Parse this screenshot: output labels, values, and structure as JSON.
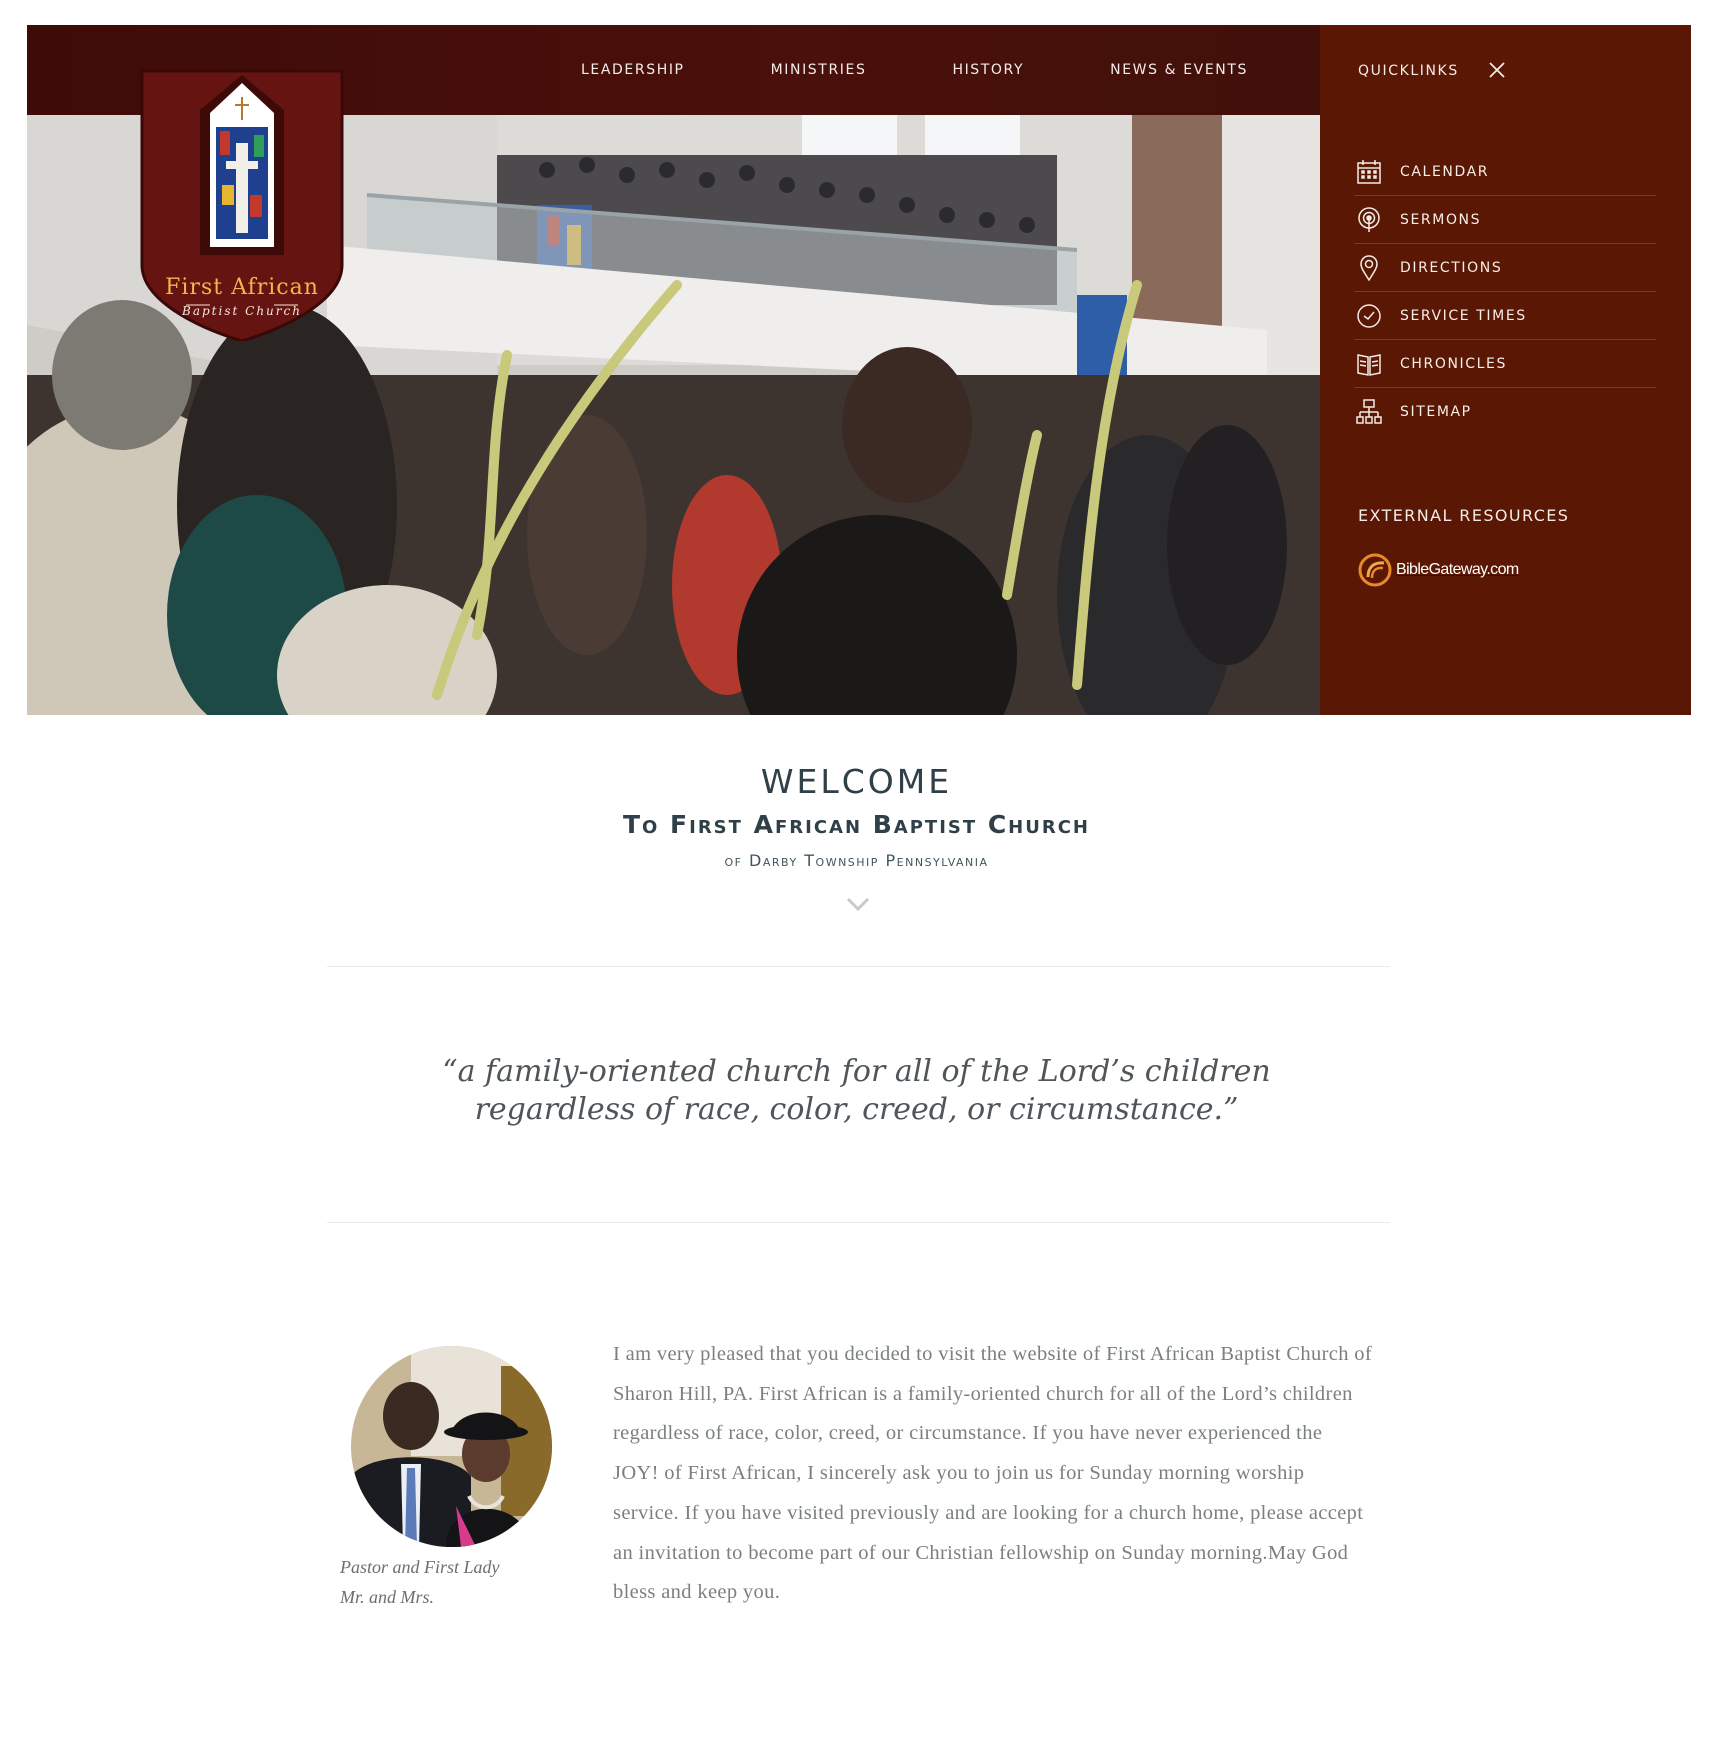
{
  "nav": {
    "items": [
      "LEADERSHIP",
      "MINISTRIES",
      "HISTORY",
      "NEWS & EVENTS"
    ]
  },
  "logo": {
    "name": "First African",
    "sub": "Baptist Church"
  },
  "quicklinks": {
    "title": "QUICKLINKS",
    "items": [
      {
        "label": "CALENDAR",
        "icon": "calendar-icon"
      },
      {
        "label": "SERMONS",
        "icon": "podcast-icon"
      },
      {
        "label": "DIRECTIONS",
        "icon": "map-pin-icon"
      },
      {
        "label": "SERVICE TIMES",
        "icon": "clock-icon"
      },
      {
        "label": "CHRONICLES",
        "icon": "book-icon"
      },
      {
        "label": "SITEMAP",
        "icon": "sitemap-icon"
      }
    ],
    "external_title": "EXTERNAL RESOURCES",
    "external_link": "BibleGateway.com"
  },
  "welcome": {
    "title": "WELCOME",
    "subtitle": "To First African Baptist Church",
    "location": "of Darby Township Pennsylvania"
  },
  "quote": {
    "line1": "“a family-oriented church for all of the Lord’s children",
    "line2": "regardless of race, color, creed, or circumstance.”"
  },
  "pastor": {
    "caption_line1": "Pastor and First Lady",
    "caption_line2": "Mr. and Mrs.",
    "letter": "I am very pleased that you decided to visit the website of First African Baptist Church of Sharon Hill, PA. First African is a family-oriented church for all of the Lord’s children regardless of race, color, creed, or circumstance. If you have never experienced the JOY! of First African, I sincerely ask you to join us for Sunday morning worship service. If you have visited previously and are looking for a church home, please accept an invitation to become part of our Christian fellowship on Sunday morning.May God bless and keep you."
  },
  "colors": {
    "topbar": "#41100a",
    "panel": "#5a1703",
    "logo_gold": "#f3b64c",
    "heading": "#2f4048",
    "body_text": "#7a7f82"
  }
}
